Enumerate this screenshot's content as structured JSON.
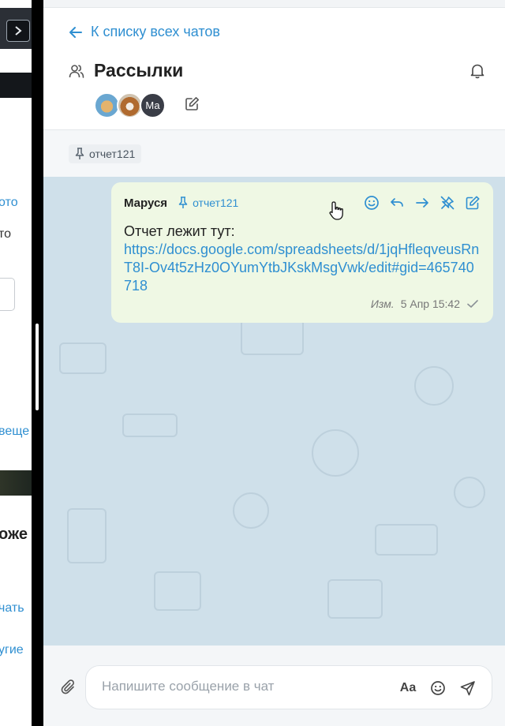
{
  "background_pane": {
    "link_1": "ото",
    "text_1": "то",
    "link_2": "веще",
    "bold_1": "оже",
    "link_3": "чать",
    "link_4": "угие"
  },
  "header": {
    "back_label": "К списку всех чатов",
    "title": "Рассылки",
    "member_initials": "Ма"
  },
  "pinned": {
    "label": "отчет121"
  },
  "message": {
    "author": "Маруся",
    "pin_label": "отчет121",
    "text": "Отчет лежит тут:",
    "link": "https://docs.google.com/spreadsheets/d/1jqHfleqveusRnT8I-Ov4t5zHz0OYumYtbJKskMsgVwk/edit#gid=465740718",
    "edited_label": "Изм.",
    "time": "5 Апр 15:42"
  },
  "composer": {
    "placeholder": "Напишите сообщение в чат",
    "format_label": "Aa"
  },
  "colors": {
    "accent": "#2f8fd1",
    "chat_bg": "#cfe0ea",
    "bubble_bg": "#eff8e4"
  }
}
